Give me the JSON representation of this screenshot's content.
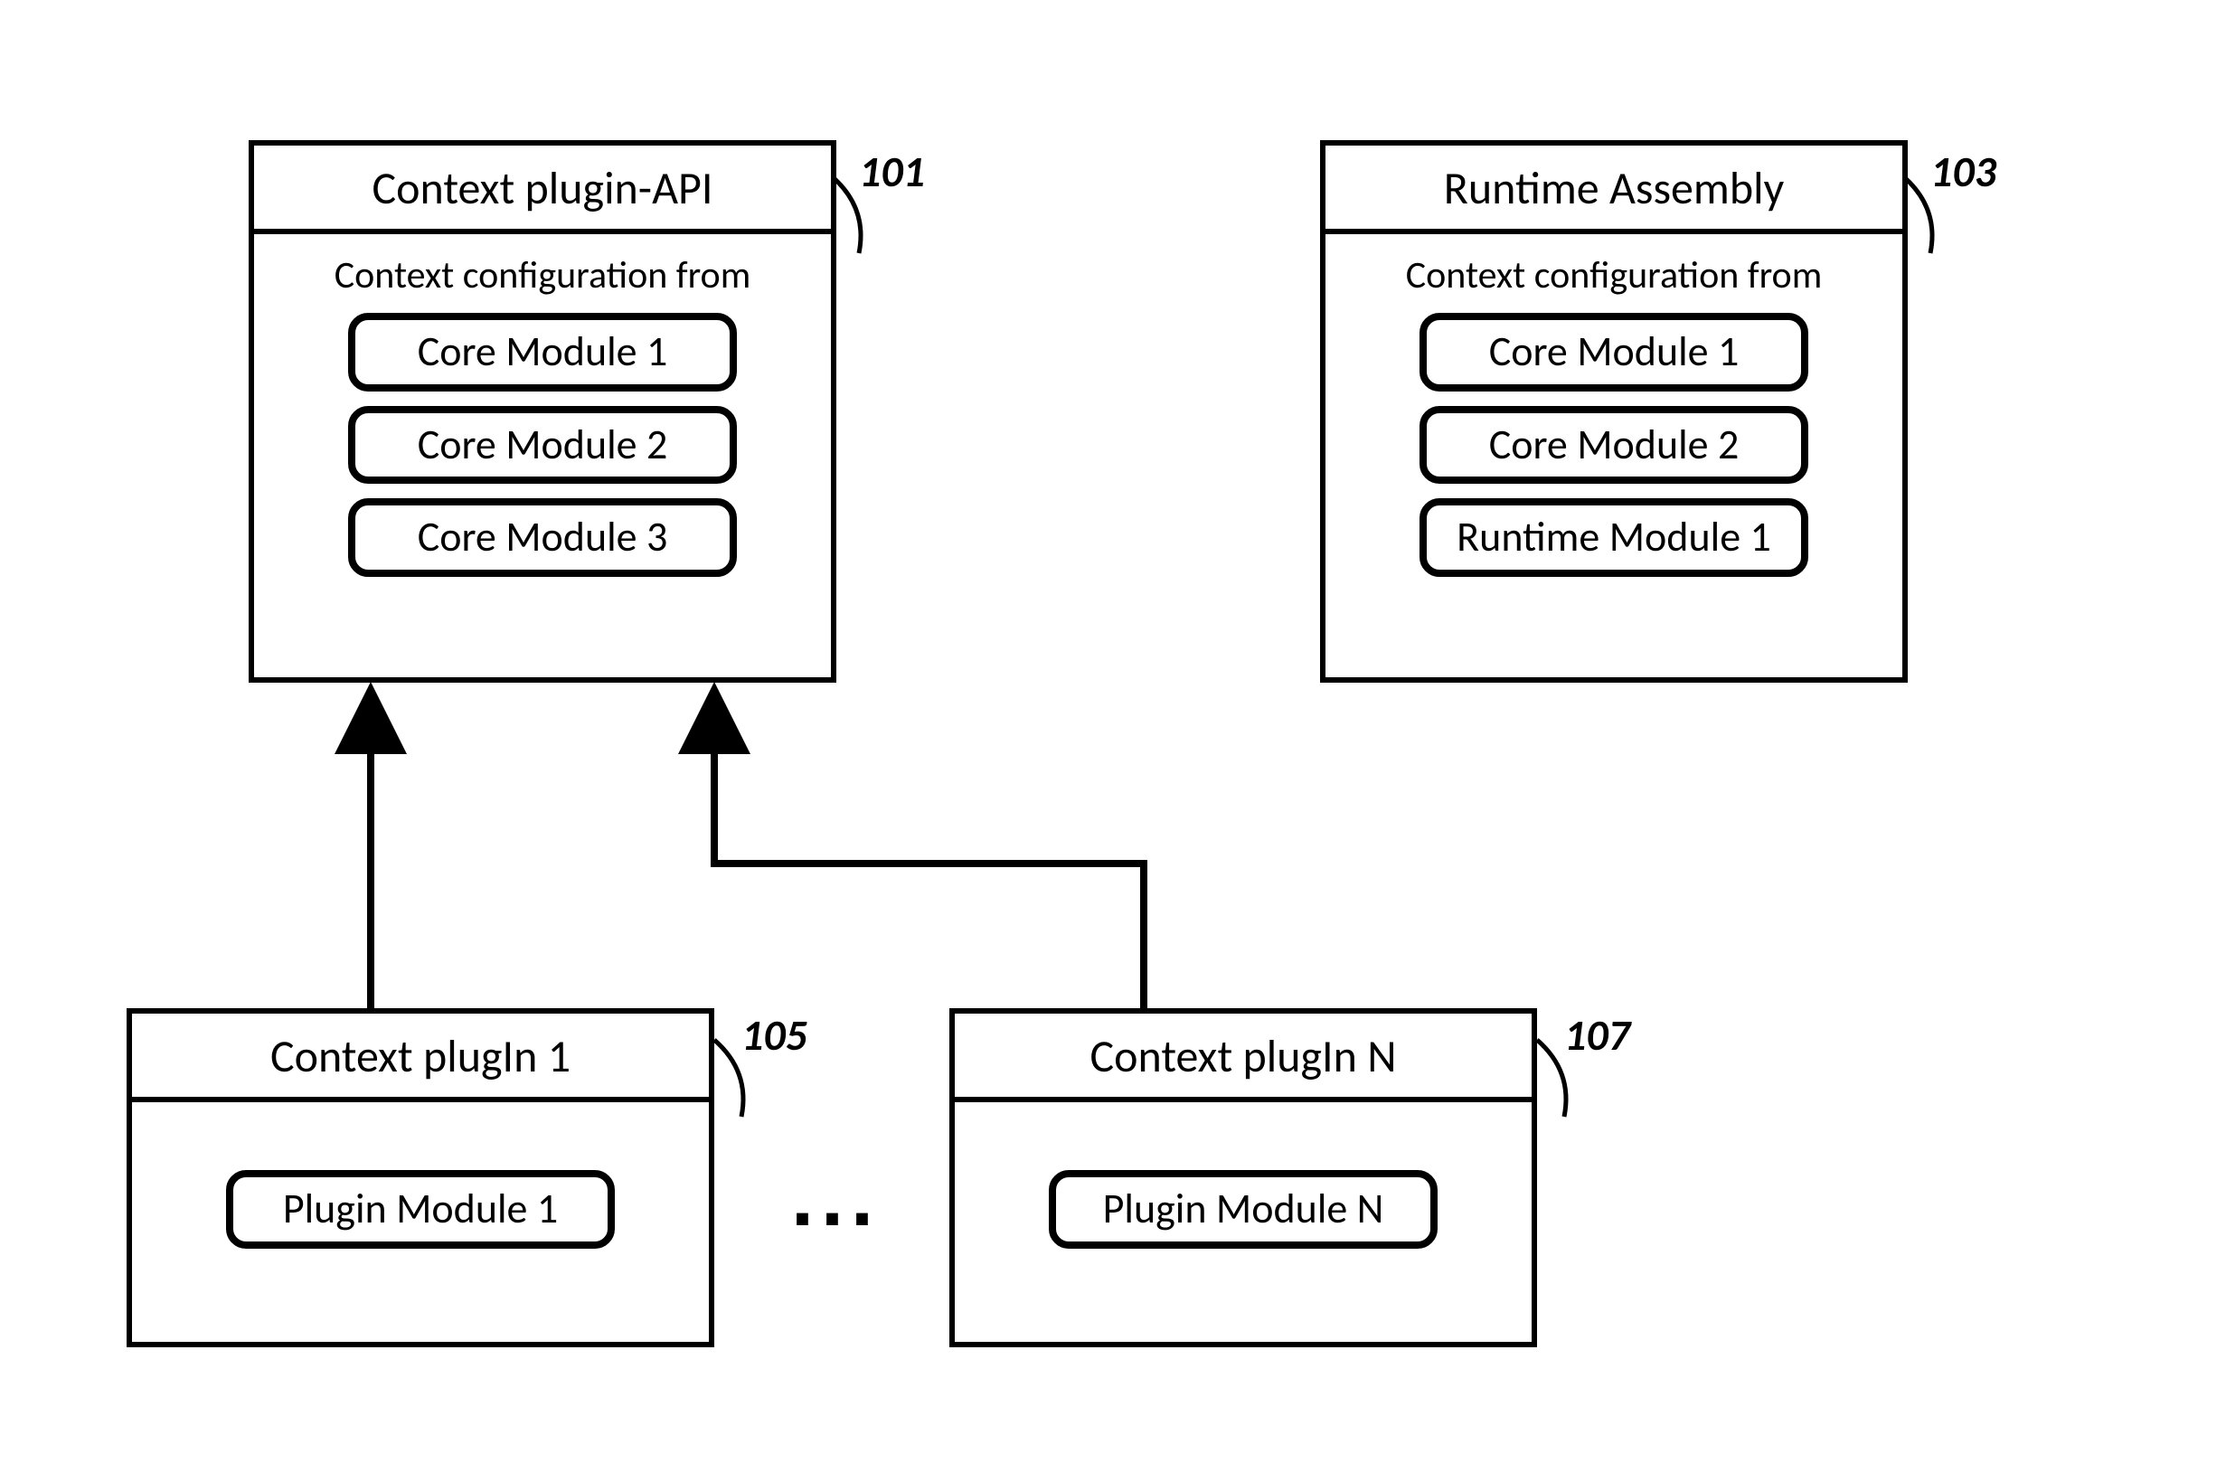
{
  "boxes": {
    "api": {
      "title": "Context plugin-API",
      "subtitle": "Context configuration from",
      "modules": [
        "Core Module 1",
        "Core Module 2",
        "Core Module 3"
      ],
      "ref": "101"
    },
    "assembly": {
      "title": "Runtime Assembly",
      "subtitle": "Context configuration from",
      "modules": [
        "Core Module 1",
        "Core Module 2",
        "Runtime Module 1"
      ],
      "ref": "103"
    },
    "plugin1": {
      "title": "Context plugIn 1",
      "modules": [
        "Plugin Module 1"
      ],
      "ref": "105"
    },
    "pluginN": {
      "title": "Context plugIn N",
      "modules": [
        "Plugin Module N"
      ],
      "ref": "107"
    }
  },
  "ellipsis": "..."
}
